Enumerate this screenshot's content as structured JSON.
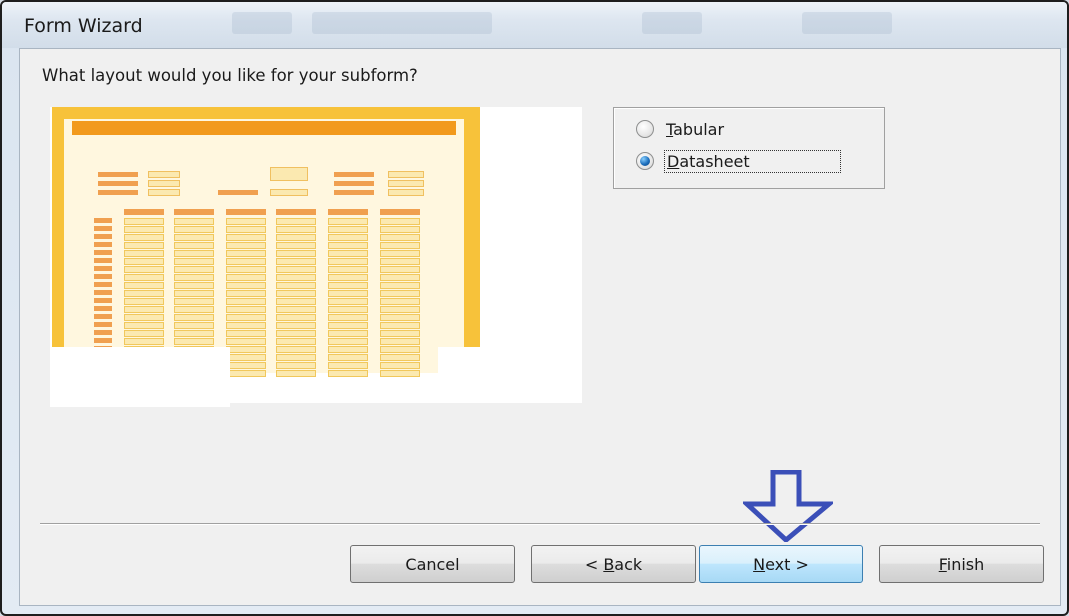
{
  "window": {
    "title": "Form Wizard"
  },
  "wizard": {
    "question": "What layout would you like for your subform?",
    "options": [
      {
        "label": "Tabular",
        "mnemonic": "T",
        "rest": "abular",
        "selected": false
      },
      {
        "label": "Datasheet",
        "mnemonic": "D",
        "rest": "atasheet",
        "selected": true
      }
    ]
  },
  "buttons": {
    "cancel": {
      "label": "Cancel"
    },
    "back": {
      "prefix": "< ",
      "mnemonic": "B",
      "rest": "ack",
      "label": "< Back"
    },
    "next": {
      "mnemonic": "N",
      "rest": "ext >",
      "label": "Next >"
    },
    "finish": {
      "mnemonic": "F",
      "rest": "inish",
      "label": "Finish"
    }
  },
  "annotation": {
    "arrow": "down-arrow",
    "color": "#3b4fb8"
  },
  "colors": {
    "accent_orange": "#f29a1d",
    "frame_yellow": "#f7c23a",
    "selected_radio": "#1d6fbd"
  }
}
